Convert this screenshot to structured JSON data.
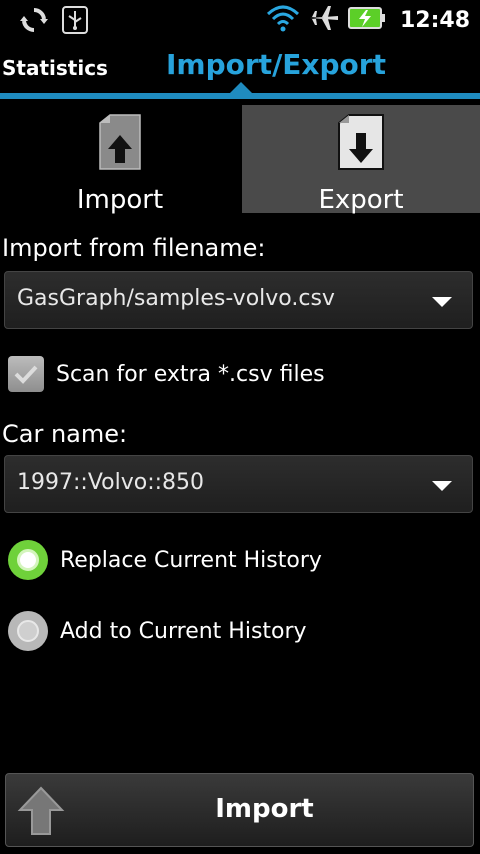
{
  "status_bar": {
    "time": "12:48",
    "icons": [
      "sync-icon",
      "usb-icon",
      "wifi-icon",
      "airplane-icon",
      "battery-charging-icon"
    ]
  },
  "title_bar": {
    "left_tab": "Statistics",
    "current_tab": "Import/Export",
    "accent_color": "#27a3dc"
  },
  "tabs": [
    {
      "label": "Import",
      "icon": "import-file-icon",
      "selected": true
    },
    {
      "label": "Export",
      "icon": "export-file-icon",
      "selected": false
    }
  ],
  "form": {
    "filename_label": "Import from filename:",
    "filename_value": "GasGraph/samples-volvo.csv",
    "scan_label": "Scan for extra *.csv files",
    "scan_checked": true,
    "car_label": "Car name:",
    "car_value": "1997::Volvo::850",
    "radio_options": [
      {
        "label": "Replace Current History",
        "selected": true
      },
      {
        "label": "Add to Current History",
        "selected": false
      }
    ]
  },
  "action_button": {
    "label": "Import",
    "icon": "up-arrow-icon"
  }
}
